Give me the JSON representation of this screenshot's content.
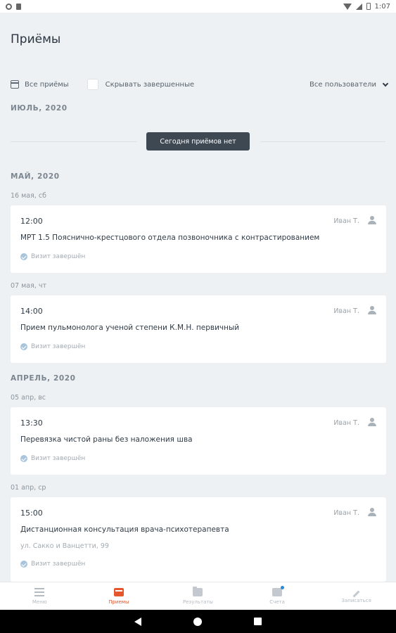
{
  "status_bar": {
    "time": "1:07"
  },
  "header": {
    "title": "Приёмы"
  },
  "filters": {
    "all_visits": "Все приёмы",
    "hide_completed": "Скрывать завершенные",
    "all_users": "Все пользователи"
  },
  "today": {
    "month": "ИЮЛЬ, 2020",
    "no_visits": "Сегодня приёмов нет"
  },
  "sections": [
    {
      "month": "МАЙ, 2020"
    },
    {
      "month": "АПРЕЛЬ, 2020"
    }
  ],
  "appointments": [
    {
      "date": "16 мая, сб",
      "time": "12:00",
      "doctor": "Иван Т.",
      "title": "МРТ 1.5 Пояснично-крестцового отдела позвоночника с контрастированием",
      "status": "Визит завершён"
    },
    {
      "date": "07 мая, чт",
      "time": "14:00",
      "doctor": "Иван Т.",
      "title": "Прием пульмонолога ученой степени К.М.Н. первичный",
      "status": "Визит завершён"
    },
    {
      "date": "05 апр, вс",
      "time": "13:30",
      "doctor": "Иван Т.",
      "title": "Перевязка чистой раны без наложения шва",
      "status": "Визит завершён"
    },
    {
      "date": "01 апр, ср",
      "time": "15:00",
      "doctor": "Иван Т.",
      "title": "Дистанционная консультация врача-психотерапевта",
      "address": "ул. Сакко и Ванцетти, 99",
      "status": "Визит завершён"
    }
  ],
  "bottom_nav": [
    {
      "label": "Меню",
      "icon": "menu-icon"
    },
    {
      "label": "Приемы",
      "icon": "visits-icon",
      "active": true
    },
    {
      "label": "Результаты",
      "icon": "results-folder-icon"
    },
    {
      "label": "Счета",
      "icon": "bills-icon"
    },
    {
      "label": "Записаться",
      "icon": "pen-icon"
    }
  ],
  "colors": {
    "accent": "#e4562b",
    "dark_button": "#3e4853",
    "background": "#eef1f3",
    "badge": "#2b8ad8"
  }
}
